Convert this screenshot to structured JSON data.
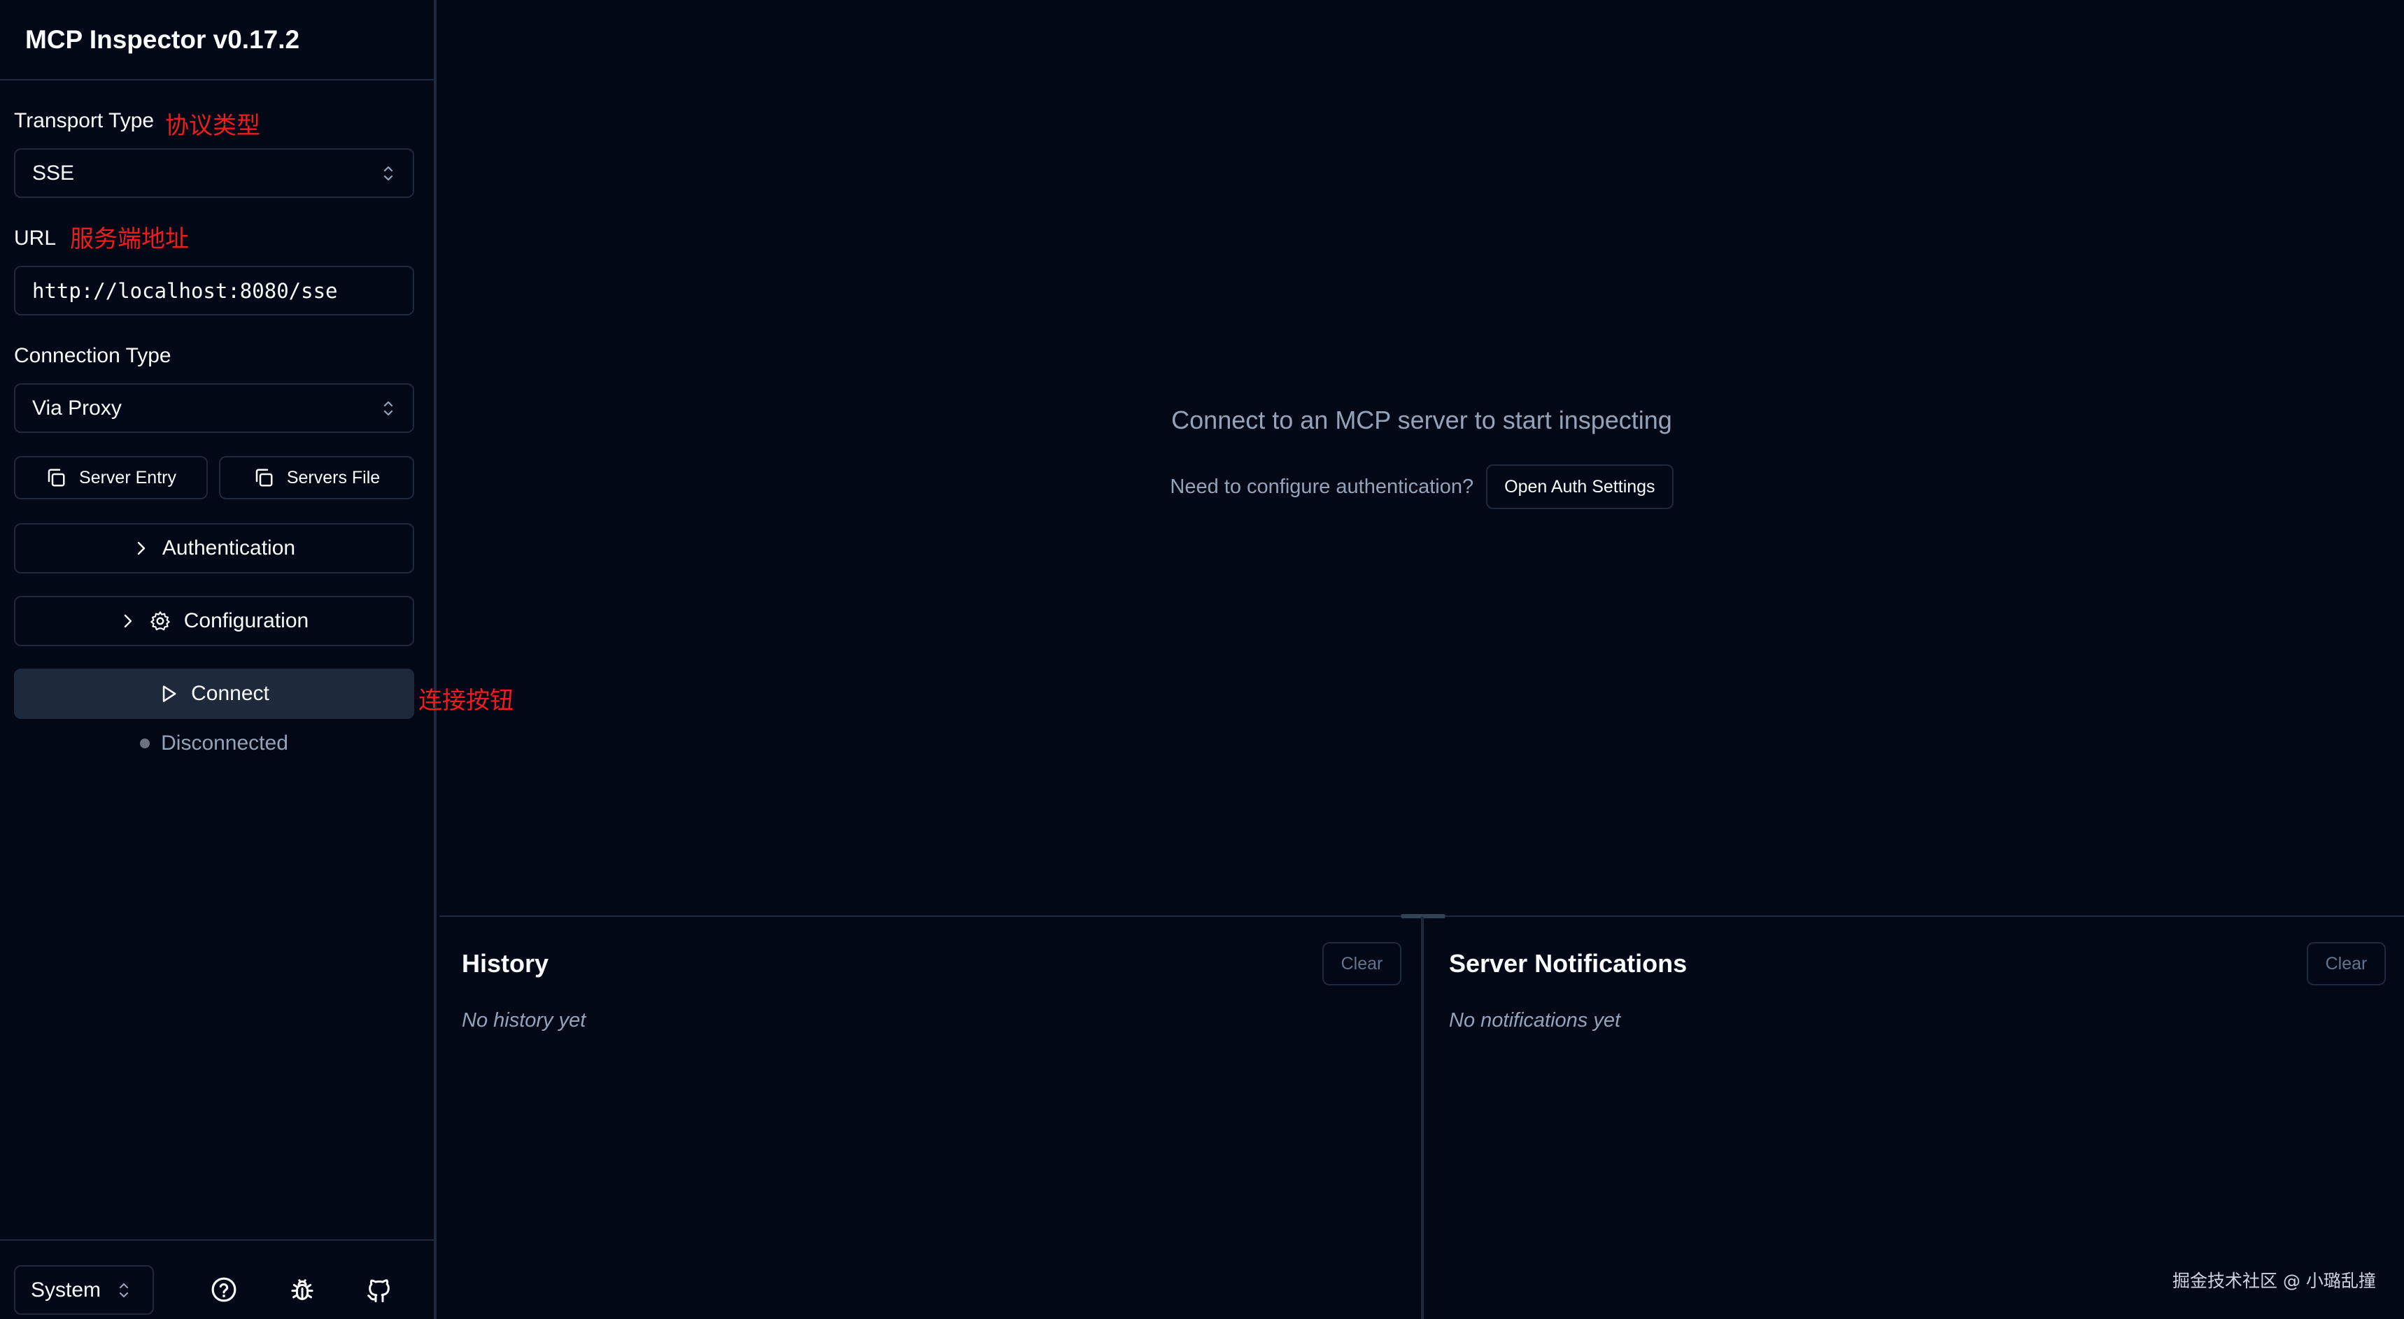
{
  "app": {
    "title": "MCP Inspector v0.17.2"
  },
  "sidebar": {
    "transport_label": "Transport Type",
    "transport_value": "SSE",
    "transport_annotation": "协议类型",
    "url_label": "URL",
    "url_value": "http://localhost:8080/sse",
    "url_annotation": "服务端地址",
    "connection_label": "Connection Type",
    "connection_value": "Via Proxy",
    "server_entry_label": "Server Entry",
    "servers_file_label": "Servers File",
    "authentication_label": "Authentication",
    "configuration_label": "Configuration",
    "connect_label": "Connect",
    "connect_annotation": "连接按钮",
    "status_text": "Disconnected",
    "status_color": "#6b7280"
  },
  "footer": {
    "theme_value": "System",
    "icons": [
      "help-circle-icon",
      "bug-icon",
      "github-icon"
    ]
  },
  "main": {
    "empty_title": "Connect to an MCP server to start inspecting",
    "auth_question": "Need to configure authentication?",
    "auth_button_label": "Open Auth Settings"
  },
  "history": {
    "title": "History",
    "clear_label": "Clear",
    "empty_text": "No history yet"
  },
  "notifications": {
    "title": "Server Notifications",
    "clear_label": "Clear",
    "empty_text": "No notifications yet"
  },
  "watermark": "掘金技术社区 @ 小璐乱撞",
  "colors": {
    "background": "#030817",
    "border": "#1e293b",
    "annotation": "#ef1c1c",
    "muted_text": "#94a3b8"
  }
}
